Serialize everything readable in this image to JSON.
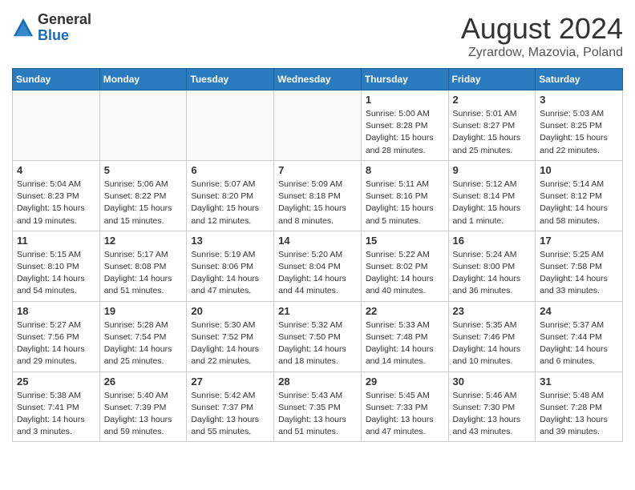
{
  "header": {
    "logo_general": "General",
    "logo_blue": "Blue",
    "title": "August 2024",
    "subtitle": "Zyrardow, Mazovia, Poland"
  },
  "calendar": {
    "days_of_week": [
      "Sunday",
      "Monday",
      "Tuesday",
      "Wednesday",
      "Thursday",
      "Friday",
      "Saturday"
    ],
    "weeks": [
      [
        {
          "day": "",
          "info": ""
        },
        {
          "day": "",
          "info": ""
        },
        {
          "day": "",
          "info": ""
        },
        {
          "day": "",
          "info": ""
        },
        {
          "day": "1",
          "info": "Sunrise: 5:00 AM\nSunset: 8:28 PM\nDaylight: 15 hours\nand 28 minutes."
        },
        {
          "day": "2",
          "info": "Sunrise: 5:01 AM\nSunset: 8:27 PM\nDaylight: 15 hours\nand 25 minutes."
        },
        {
          "day": "3",
          "info": "Sunrise: 5:03 AM\nSunset: 8:25 PM\nDaylight: 15 hours\nand 22 minutes."
        }
      ],
      [
        {
          "day": "4",
          "info": "Sunrise: 5:04 AM\nSunset: 8:23 PM\nDaylight: 15 hours\nand 19 minutes."
        },
        {
          "day": "5",
          "info": "Sunrise: 5:06 AM\nSunset: 8:22 PM\nDaylight: 15 hours\nand 15 minutes."
        },
        {
          "day": "6",
          "info": "Sunrise: 5:07 AM\nSunset: 8:20 PM\nDaylight: 15 hours\nand 12 minutes."
        },
        {
          "day": "7",
          "info": "Sunrise: 5:09 AM\nSunset: 8:18 PM\nDaylight: 15 hours\nand 8 minutes."
        },
        {
          "day": "8",
          "info": "Sunrise: 5:11 AM\nSunset: 8:16 PM\nDaylight: 15 hours\nand 5 minutes."
        },
        {
          "day": "9",
          "info": "Sunrise: 5:12 AM\nSunset: 8:14 PM\nDaylight: 15 hours\nand 1 minute."
        },
        {
          "day": "10",
          "info": "Sunrise: 5:14 AM\nSunset: 8:12 PM\nDaylight: 14 hours\nand 58 minutes."
        }
      ],
      [
        {
          "day": "11",
          "info": "Sunrise: 5:15 AM\nSunset: 8:10 PM\nDaylight: 14 hours\nand 54 minutes."
        },
        {
          "day": "12",
          "info": "Sunrise: 5:17 AM\nSunset: 8:08 PM\nDaylight: 14 hours\nand 51 minutes."
        },
        {
          "day": "13",
          "info": "Sunrise: 5:19 AM\nSunset: 8:06 PM\nDaylight: 14 hours\nand 47 minutes."
        },
        {
          "day": "14",
          "info": "Sunrise: 5:20 AM\nSunset: 8:04 PM\nDaylight: 14 hours\nand 44 minutes."
        },
        {
          "day": "15",
          "info": "Sunrise: 5:22 AM\nSunset: 8:02 PM\nDaylight: 14 hours\nand 40 minutes."
        },
        {
          "day": "16",
          "info": "Sunrise: 5:24 AM\nSunset: 8:00 PM\nDaylight: 14 hours\nand 36 minutes."
        },
        {
          "day": "17",
          "info": "Sunrise: 5:25 AM\nSunset: 7:58 PM\nDaylight: 14 hours\nand 33 minutes."
        }
      ],
      [
        {
          "day": "18",
          "info": "Sunrise: 5:27 AM\nSunset: 7:56 PM\nDaylight: 14 hours\nand 29 minutes."
        },
        {
          "day": "19",
          "info": "Sunrise: 5:28 AM\nSunset: 7:54 PM\nDaylight: 14 hours\nand 25 minutes."
        },
        {
          "day": "20",
          "info": "Sunrise: 5:30 AM\nSunset: 7:52 PM\nDaylight: 14 hours\nand 22 minutes."
        },
        {
          "day": "21",
          "info": "Sunrise: 5:32 AM\nSunset: 7:50 PM\nDaylight: 14 hours\nand 18 minutes."
        },
        {
          "day": "22",
          "info": "Sunrise: 5:33 AM\nSunset: 7:48 PM\nDaylight: 14 hours\nand 14 minutes."
        },
        {
          "day": "23",
          "info": "Sunrise: 5:35 AM\nSunset: 7:46 PM\nDaylight: 14 hours\nand 10 minutes."
        },
        {
          "day": "24",
          "info": "Sunrise: 5:37 AM\nSunset: 7:44 PM\nDaylight: 14 hours\nand 6 minutes."
        }
      ],
      [
        {
          "day": "25",
          "info": "Sunrise: 5:38 AM\nSunset: 7:41 PM\nDaylight: 14 hours\nand 3 minutes."
        },
        {
          "day": "26",
          "info": "Sunrise: 5:40 AM\nSunset: 7:39 PM\nDaylight: 13 hours\nand 59 minutes."
        },
        {
          "day": "27",
          "info": "Sunrise: 5:42 AM\nSunset: 7:37 PM\nDaylight: 13 hours\nand 55 minutes."
        },
        {
          "day": "28",
          "info": "Sunrise: 5:43 AM\nSunset: 7:35 PM\nDaylight: 13 hours\nand 51 minutes."
        },
        {
          "day": "29",
          "info": "Sunrise: 5:45 AM\nSunset: 7:33 PM\nDaylight: 13 hours\nand 47 minutes."
        },
        {
          "day": "30",
          "info": "Sunrise: 5:46 AM\nSunset: 7:30 PM\nDaylight: 13 hours\nand 43 minutes."
        },
        {
          "day": "31",
          "info": "Sunrise: 5:48 AM\nSunset: 7:28 PM\nDaylight: 13 hours\nand 39 minutes."
        }
      ]
    ]
  }
}
